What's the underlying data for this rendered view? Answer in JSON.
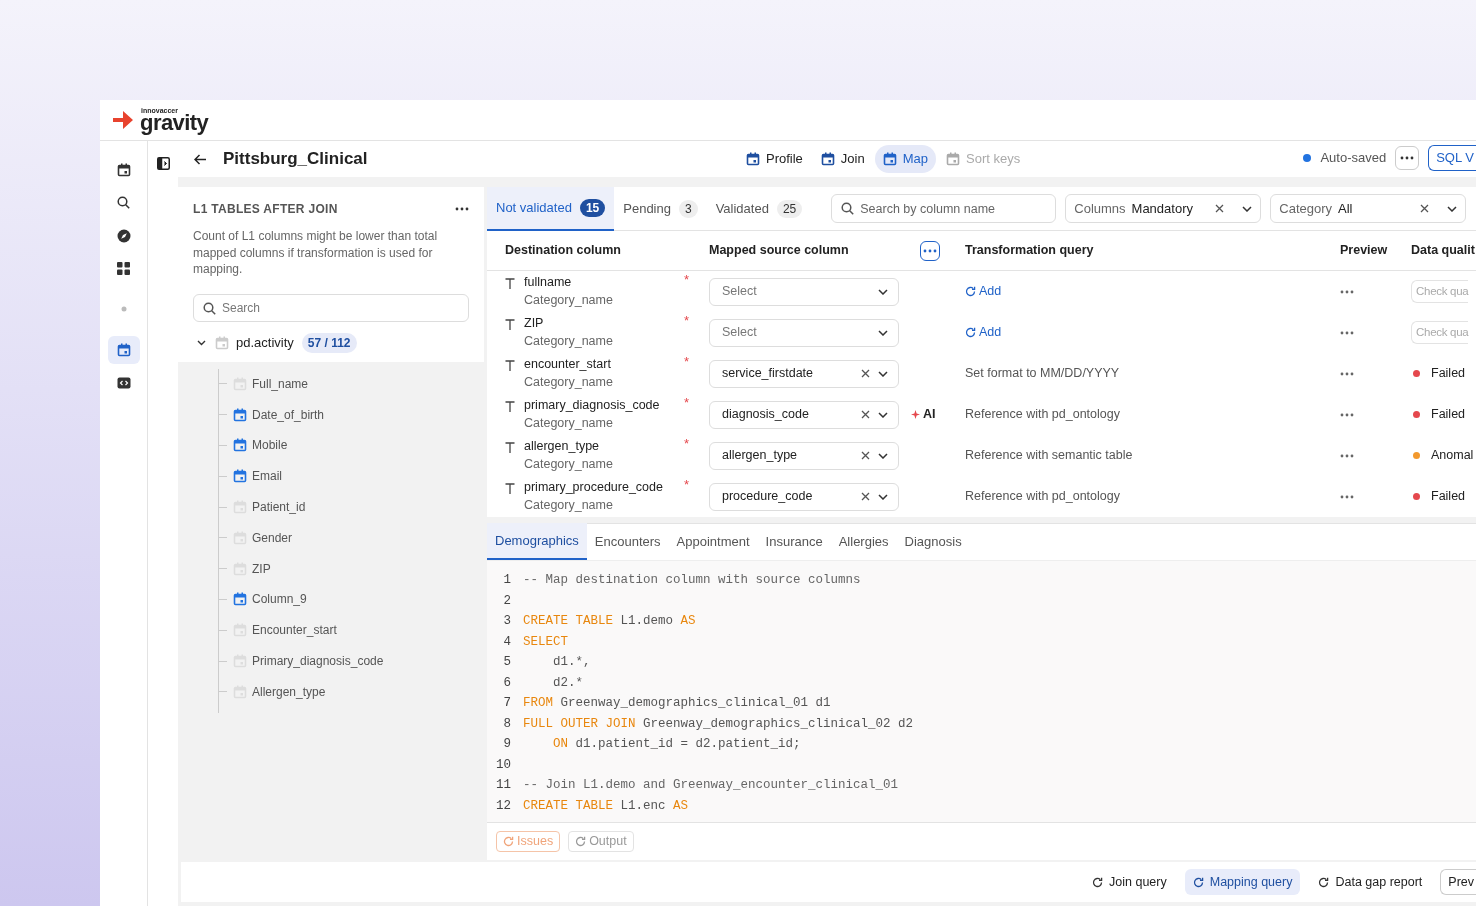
{
  "logo": {
    "brand": "innovaccer",
    "product": "gravity"
  },
  "rail": [
    {
      "kind": "calendar",
      "selected": false
    },
    {
      "kind": "search",
      "selected": false
    },
    {
      "kind": "compass",
      "selected": false
    },
    {
      "kind": "grid",
      "selected": false
    },
    {
      "kind": "dot",
      "selected": false
    },
    {
      "kind": "calendar",
      "selected": true
    },
    {
      "kind": "code",
      "selected": false
    }
  ],
  "header": {
    "title": "Pittsburg_Clinical",
    "nav": [
      {
        "label": "Profile",
        "selected": false,
        "disabled": false
      },
      {
        "label": "Join",
        "selected": false,
        "disabled": false
      },
      {
        "label": "Map",
        "selected": true,
        "disabled": false
      },
      {
        "label": "Sort keys",
        "selected": false,
        "disabled": true
      }
    ],
    "status": "Auto-saved",
    "sql_button": "SQL V"
  },
  "left_panel": {
    "title": "L1 TABLES AFTER JOIN",
    "note": "Count of L1 columns might be lower than total mapped columns if transformation is used for mapping.",
    "search_placeholder": "Search",
    "tree": {
      "label": "pd.activity",
      "count": "57 / 112",
      "expanded": true,
      "children": [
        {
          "label": "Full_name",
          "mapped": false
        },
        {
          "label": "Date_of_birth",
          "mapped": true
        },
        {
          "label": "Mobile",
          "mapped": true
        },
        {
          "label": "Email",
          "mapped": true
        },
        {
          "label": "Patient_id",
          "mapped": false
        },
        {
          "label": "Gender",
          "mapped": false
        },
        {
          "label": "ZIP",
          "mapped": false
        },
        {
          "label": "Column_9",
          "mapped": true
        },
        {
          "label": "Encounter_start",
          "mapped": false
        },
        {
          "label": "Primary_diagnosis_code",
          "mapped": false
        },
        {
          "label": "Allergen_type",
          "mapped": false
        }
      ]
    }
  },
  "status_tabs": [
    {
      "label": "Not validated",
      "count": "15",
      "selected": true
    },
    {
      "label": "Pending",
      "count": "3",
      "selected": false
    },
    {
      "label": "Validated",
      "count": "25",
      "selected": false
    }
  ],
  "search": {
    "placeholder": "Search by column name"
  },
  "filters": [
    {
      "label": "Columns",
      "value": "Mandatory"
    },
    {
      "label": "Category",
      "value": "All"
    }
  ],
  "columns": [
    "Destination column",
    "Mapped source column",
    "Transformation query",
    "Preview",
    "Data qualit"
  ],
  "rows": [
    {
      "name": "fullname",
      "marker": "*",
      "category": "Category_name",
      "source": {
        "kind": "placeholder",
        "text": "Select"
      },
      "transform": {
        "kind": "add",
        "text": "Add"
      },
      "quality": {
        "kind": "button",
        "text": "Check qua"
      }
    },
    {
      "name": "ZIP",
      "marker": "*",
      "category": "Category_name",
      "source": {
        "kind": "placeholder",
        "text": "Select"
      },
      "transform": {
        "kind": "add",
        "text": "Add"
      },
      "quality": {
        "kind": "button",
        "text": "Check qua"
      }
    },
    {
      "name": "encounter_start",
      "marker": "*",
      "category": "Category_name",
      "source": {
        "kind": "value",
        "text": "service_firstdate"
      },
      "transform": {
        "kind": "text",
        "text": "Set format to MM/DD/YYYY"
      },
      "quality": {
        "kind": "status",
        "text": "Failed",
        "color": "#e5484d"
      }
    },
    {
      "name": "primary_diagnosis_code",
      "marker": "*",
      "category": "Category_name",
      "source": {
        "kind": "value",
        "text": "diagnosis_code"
      },
      "ai_label": "AI",
      "transform": {
        "kind": "text",
        "text": "Reference with pd_ontology"
      },
      "quality": {
        "kind": "status",
        "text": "Failed",
        "color": "#e5484d"
      }
    },
    {
      "name": "allergen_type",
      "marker": "*",
      "category": "Category_name",
      "source": {
        "kind": "value",
        "text": "allergen_type"
      },
      "transform": {
        "kind": "text",
        "text": "Reference with semantic table"
      },
      "quality": {
        "kind": "status",
        "text": "Anomal",
        "color": "#f2992e"
      }
    },
    {
      "name": "primary_procedure_code",
      "marker": "*",
      "category": "Category_name",
      "source": {
        "kind": "value",
        "text": "procedure_code"
      },
      "transform": {
        "kind": "text",
        "text": "Reference with pd_ontology"
      },
      "quality": {
        "kind": "status",
        "text": "Failed",
        "color": "#e5484d"
      }
    }
  ],
  "code_tabs": [
    {
      "label": "Demographics",
      "selected": true
    },
    {
      "label": "Encounters",
      "selected": false
    },
    {
      "label": "Appointment",
      "selected": false
    },
    {
      "label": "Insurance",
      "selected": false
    },
    {
      "label": "Allergies",
      "selected": false
    },
    {
      "label": "Diagnosis",
      "selected": false
    }
  ],
  "code": [
    {
      "n": "1",
      "parts": [
        {
          "kind": "comment",
          "text": "-- Map destination column with source columns"
        }
      ]
    },
    {
      "n": "2"
    },
    {
      "n": "3",
      "parts": [
        {
          "kind": "keyword",
          "text": "CREATE TABLE"
        },
        {
          "kind": "plain",
          "text": " L1.demo "
        },
        {
          "kind": "keyword",
          "text": "AS"
        }
      ]
    },
    {
      "n": "4",
      "parts": [
        {
          "kind": "keyword",
          "text": "SELECT"
        }
      ]
    },
    {
      "n": "5",
      "indented": true,
      "parts": [
        {
          "kind": "plain",
          "text": "d1.*,"
        }
      ]
    },
    {
      "n": "6",
      "indented": true,
      "parts": [
        {
          "kind": "plain",
          "text": "d2.*"
        }
      ]
    },
    {
      "n": "7",
      "parts": [
        {
          "kind": "keyword",
          "text": "FROM"
        },
        {
          "kind": "plain",
          "text": " Greenway_demographics_clinical_01 d1"
        }
      ]
    },
    {
      "n": "8",
      "parts": [
        {
          "kind": "keyword",
          "text": "FULL OUTER JOIN"
        },
        {
          "kind": "plain",
          "text": " Greenway_demographics_clinical_02 d2"
        }
      ]
    },
    {
      "n": "9",
      "indented": true,
      "parts": [
        {
          "kind": "keyword",
          "text": "ON"
        },
        {
          "kind": "plain",
          "text": " d1.patient_id = d2.patient_id;"
        }
      ]
    },
    {
      "n": "10"
    },
    {
      "n": "11",
      "parts": [
        {
          "kind": "comment",
          "text": "-- Join L1.demo and Greenway_encounter_clinical_01"
        }
      ]
    },
    {
      "n": "12",
      "parts": [
        {
          "kind": "keyword",
          "text": "CREATE TABLE"
        },
        {
          "kind": "plain",
          "text": " L1.enc "
        },
        {
          "kind": "keyword",
          "text": "AS"
        }
      ]
    }
  ],
  "console_buttons": [
    {
      "label": "Issues",
      "kind": "warning"
    },
    {
      "label": "Output",
      "kind": "neutral"
    }
  ],
  "footer_buttons": [
    {
      "label": "Join query",
      "kind": "link",
      "selected": false
    },
    {
      "label": "Mapping query",
      "kind": "link",
      "selected": true
    },
    {
      "label": "Data gap report",
      "kind": "link",
      "selected": false
    },
    {
      "label": "Prev",
      "kind": "outline",
      "selected": false
    }
  ]
}
